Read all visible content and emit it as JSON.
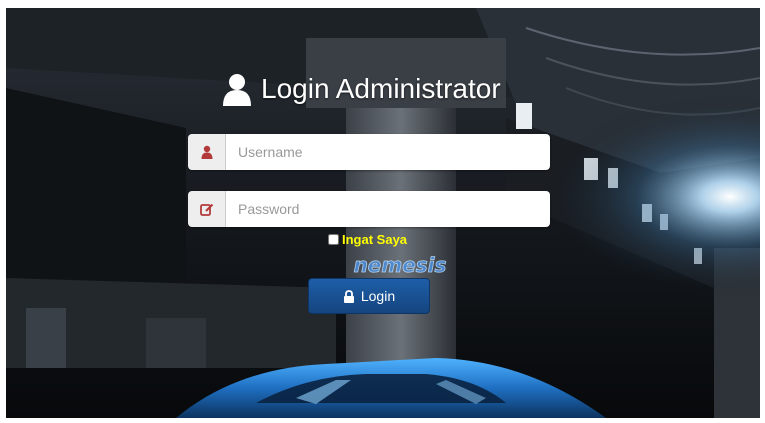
{
  "header": {
    "title": "Login Administrator",
    "icon": "user-icon"
  },
  "form": {
    "username": {
      "placeholder": "Username",
      "value": "",
      "icon": "user-icon"
    },
    "password": {
      "placeholder": "Password",
      "value": "",
      "icon": "edit-icon"
    },
    "remember": {
      "label": "Ingat Saya",
      "checked": false
    },
    "submit": {
      "label": "Login",
      "icon": "lock-icon"
    }
  },
  "background": {
    "watermark": "nemesis"
  },
  "colors": {
    "accent": "#1a4f91",
    "icon_red": "#b33a3a",
    "remember_text": "#ffff00",
    "watermark": "#4a8fe0"
  }
}
